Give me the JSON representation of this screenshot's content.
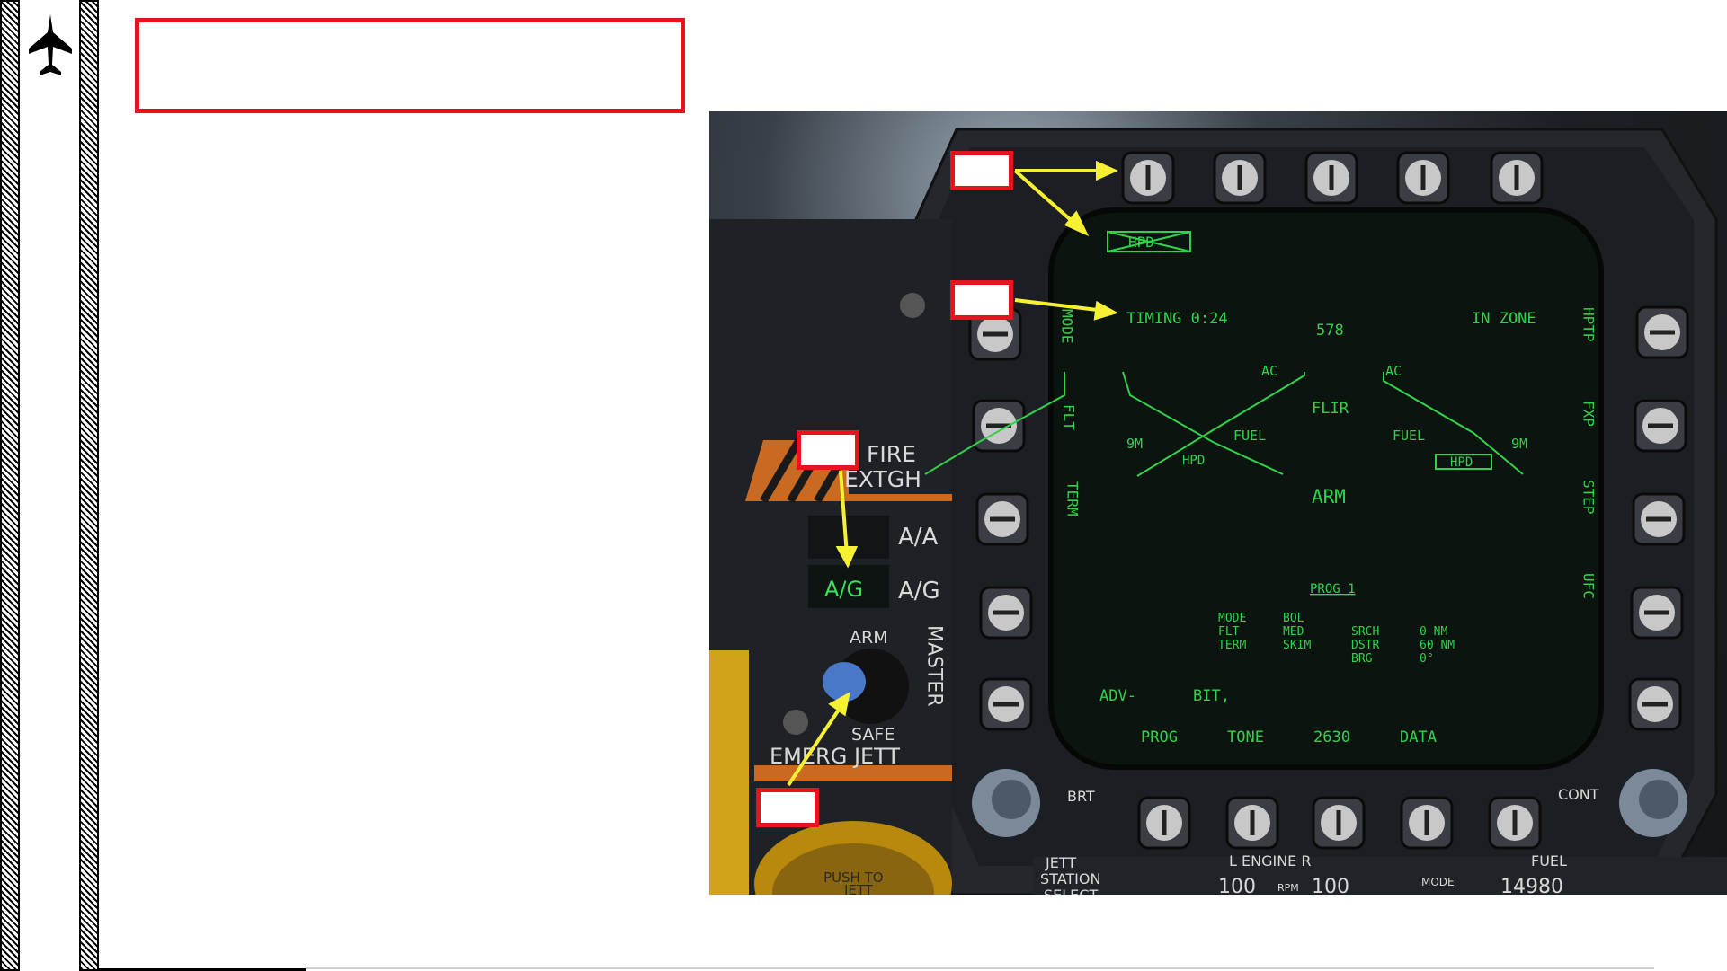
{
  "mfd": {
    "top_legend": "HPD",
    "timing": "TIMING 0:24",
    "range": "578",
    "in_zone": "IN ZONE",
    "ac_left": "AC",
    "ac_right": "AC",
    "flir": "FLIR",
    "fuel_left": "FUEL",
    "fuel_right": "FUEL",
    "nm_left": "9M",
    "nm_right": "9M",
    "hpd_left": "HPD",
    "hpd_right": "HPD",
    "arm": "ARM",
    "prog_title": "PROG 1",
    "table": {
      "col1": [
        "MODE",
        "FLT",
        "TERM"
      ],
      "col2": [
        "BOL",
        "MED",
        "SKIM"
      ],
      "col3": [
        "SRCH",
        "DSTR",
        "BRG"
      ],
      "col4": [
        "0 NM",
        "60 NM",
        "0°"
      ]
    },
    "adv": "ADV-",
    "bit": "BIT,",
    "bottom_labels": [
      "PROG",
      "TONE",
      "2630",
      "DATA"
    ],
    "left_labels": [
      "MODE",
      "FLT",
      "TERM"
    ],
    "right_labels": [
      "HPTP",
      "FXP",
      "STEP",
      "UFC"
    ],
    "brt": "BRT",
    "cont": "CONT"
  },
  "panel": {
    "fire": "FIRE",
    "extgh": "EXTGH",
    "aa": "A/A",
    "ag_lit": "A/G",
    "ag": "A/G",
    "arm": "ARM",
    "safe": "SAFE",
    "master": "MASTER",
    "emerg_jett": "EMERG  JETT",
    "push_to": "PUSH TO",
    "jett": "JETT"
  },
  "lower_panel": {
    "jett": "JETT",
    "station_select": "STATION",
    "select": "SELECT",
    "engine": "L  ENGINE  R",
    "rpm_left": "100",
    "rpm": "RPM",
    "rpm_right": "100",
    "mode": "MODE",
    "fuel": "FUEL",
    "fuel_value": "14980"
  },
  "colors": {
    "callout_red": "#e6141e",
    "arrow_yellow": "#f5f032",
    "mfd_green": "#2fd24a"
  }
}
